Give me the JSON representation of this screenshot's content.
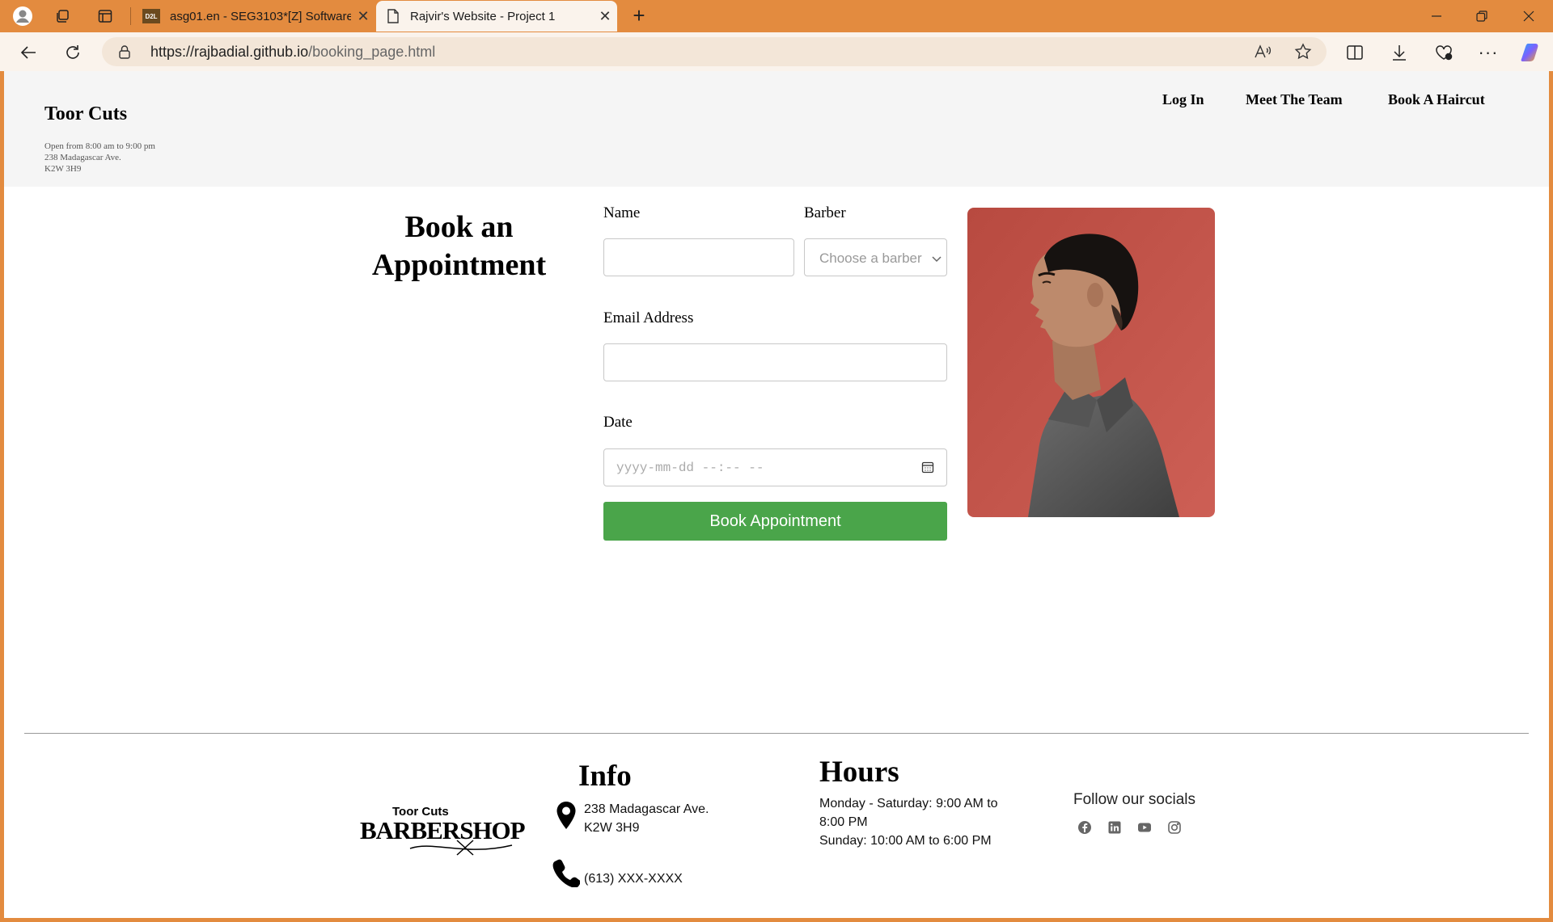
{
  "browser": {
    "tabs": [
      {
        "title": "asg01.en - SEG3103*[Z] Software",
        "favicon": "D2L"
      },
      {
        "title": "Rajvir's Website - Project 1"
      }
    ],
    "url_host": "https://rajbadial.github.io",
    "url_path": "/booking_page.html"
  },
  "header": {
    "brand": "Toor Cuts",
    "hours_line": "Open from 8:00 am to 9:00 pm",
    "address_line1": "238 Madagascar Ave.",
    "address_line2": "K2W 3H9",
    "nav": {
      "login": "Log In",
      "team": "Meet The Team",
      "book": "Book A Haircut"
    }
  },
  "form": {
    "title": "Book an Appointment",
    "name_label": "Name",
    "barber_label": "Barber",
    "barber_placeholder": "Choose a barber",
    "email_label": "Email Address",
    "date_label": "Date",
    "date_placeholder": "yyyy-mm-dd  --:--  --",
    "submit": "Book Appointment"
  },
  "footer": {
    "logo_top": "Toor Cuts",
    "logo_main": "BARBERSHOP",
    "info_title": "Info",
    "address_line1": "238 Madagascar Ave.",
    "address_line2": "K2W 3H9",
    "phone": "(613) XXX-XXXX",
    "hours_title": "Hours",
    "hours_line1": "Monday - Saturday: 9:00 AM to",
    "hours_line2": "8:00 PM",
    "hours_line3": "Sunday: 10:00 AM to 6:00 PM",
    "social_title": "Follow our socials",
    "socials": [
      "facebook-icon",
      "linkedin-icon",
      "youtube-icon",
      "instagram-icon"
    ]
  },
  "colors": {
    "chrome": "#e38b3f",
    "button": "#4aa54a",
    "photo_bg": "#c4574c"
  }
}
